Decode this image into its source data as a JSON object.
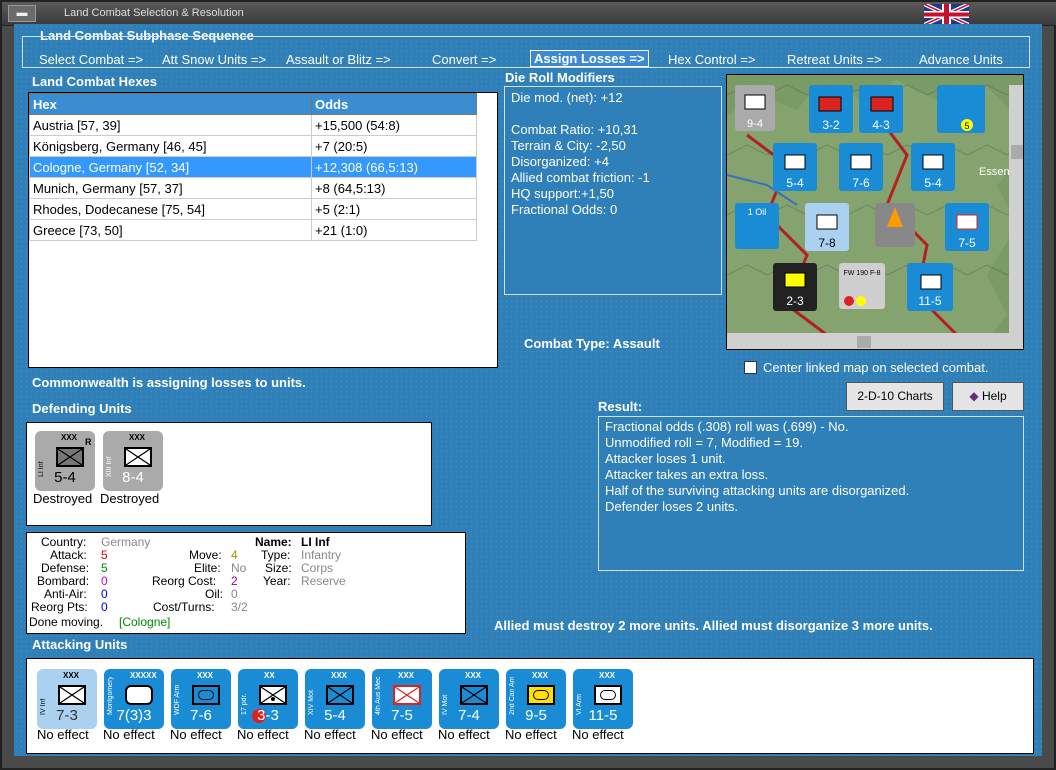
{
  "window": {
    "title": "Land Combat Selection & Resolution"
  },
  "subphase": {
    "title": "Land Combat Subphase Sequence",
    "steps": [
      "Select Combat =>",
      "Att Snow Units =>",
      "Assault or Blitz =>",
      "Convert =>",
      "Assign Losses =>",
      "Hex Control =>",
      "Retreat Units =>",
      "Advance Units"
    ]
  },
  "hexes": {
    "title": "Land Combat Hexes",
    "headers": [
      "Hex",
      "Odds"
    ],
    "rows": [
      [
        "Austria [57, 39]",
        "+15,500 (54:8)"
      ],
      [
        "Königsberg, Germany [46, 45]",
        "+7 (20:5)"
      ],
      [
        "Cologne, Germany [52, 34]",
        "+12,308 (66,5:13)"
      ],
      [
        "Munich, Germany [57, 37]",
        "+8 (64,5:13)"
      ],
      [
        "Rhodes, Dodecanese [75, 54]",
        "+5 (2:1)"
      ],
      [
        "Greece [73, 50]",
        "+21 (1:0)"
      ]
    ]
  },
  "die_roll": {
    "title": "Die Roll Modifiers",
    "lines": [
      "Die mod. (net): +12",
      "",
      "Combat Ratio: +10,31",
      "Terrain & City: -2,50",
      "Disorganized: +4",
      "Allied combat friction: -1",
      "HQ support:+1,50",
      "Fractional Odds: 0"
    ]
  },
  "combat_type": "Combat Type:  Assault",
  "center_map": "Center linked map on selected combat.",
  "status": "Commonwealth is assigning losses to units.",
  "buttons": {
    "charts": "2-D-10 Charts",
    "help": "Help"
  },
  "defending": {
    "title": "Defending Units",
    "units": [
      {
        "name": "LI Inf",
        "size": "XXX",
        "values": "5-4",
        "caption": "Destroyed",
        "corner": "R"
      },
      {
        "name": "XIII Inf",
        "size": "XXX",
        "values": "8-4",
        "caption": "Destroyed",
        "corner": ""
      }
    ]
  },
  "unit_info": {
    "country_label": "Country:",
    "country": "Germany",
    "attack_label": "Attack:",
    "attack": "5",
    "defense_label": "Defense:",
    "defense": "5",
    "bombard_label": "Bombard:",
    "bombard": "0",
    "antiair_label": "Anti-Air:",
    "antiair": "0",
    "reorg_pts_label": "Reorg Pts:",
    "reorg_pts": "0",
    "done_moving": "Done moving.",
    "done_moving_loc": "[Cologne]",
    "move_label": "Move:",
    "move": "4",
    "elite_label": "Elite:",
    "elite": "No",
    "reorg_cost_label": "Reorg Cost:",
    "reorg_cost": "2",
    "oil_label": "Oil:",
    "oil": "0",
    "cost_turns_label": "Cost/Turns:",
    "cost_turns": "3/2",
    "name_label": "Name:",
    "name": "LI Inf",
    "type_label": "Type:",
    "type": "Infantry",
    "size_label": "Size:",
    "size": "Corps",
    "year_label": "Year:",
    "year": "Reserve"
  },
  "result": {
    "title": "Result:",
    "lines": [
      "Fractional odds (.308) roll was (.699)  - No.",
      "Unmodified roll = 7, Modified = 19.",
      "Attacker loses 1 unit.",
      "Attacker takes an extra loss.",
      "Half of the surviving attacking units are disorganized.",
      "Defender loses 2 units."
    ]
  },
  "allied_note": "Allied must destroy 2 more units. Allied must disorganize 3 more units.",
  "attacking": {
    "title": "Attacking Units",
    "units": [
      {
        "name": "IV Inf",
        "size": "XXX",
        "values": "7-3",
        "caption": "No effect"
      },
      {
        "name": "Montgomery",
        "size": "XXXXX",
        "values": "7(3)3",
        "caption": "No effect"
      },
      {
        "name": "WDF Arm",
        "size": "XXX",
        "values": "7-6",
        "caption": "No effect"
      },
      {
        "name": "17 pdr.",
        "size": "XX",
        "values": "3-3",
        "caption": "No effect"
      },
      {
        "name": "XIV Mot",
        "size": "XXX",
        "values": "5-4",
        "caption": "No effect"
      },
      {
        "name": "4th Aus Mech",
        "size": "XXX",
        "values": "7-5",
        "caption": "No effect"
      },
      {
        "name": "IV Mot",
        "size": "XXX",
        "values": "7-4",
        "caption": "No effect"
      },
      {
        "name": "2nd Can Arm",
        "size": "XXX",
        "values": "9-5",
        "caption": "No effect"
      },
      {
        "name": "VI Arm",
        "size": "XXX",
        "values": "11-5",
        "caption": "No effect"
      }
    ]
  },
  "map": {
    "counters": [
      "9-4",
      "3-2",
      "4-3",
      "5",
      "5-4",
      "7-6",
      "5-4",
      "7-8",
      "7-5",
      "2-3",
      "11-5",
      "1 Oil",
      "FW 190 F-8",
      "Essen"
    ]
  },
  "colors": {
    "background": "#2f7fb8",
    "selected_row": "#3399ff",
    "header": "#3a8dd1",
    "counter_blue": "#1a8cd6"
  }
}
